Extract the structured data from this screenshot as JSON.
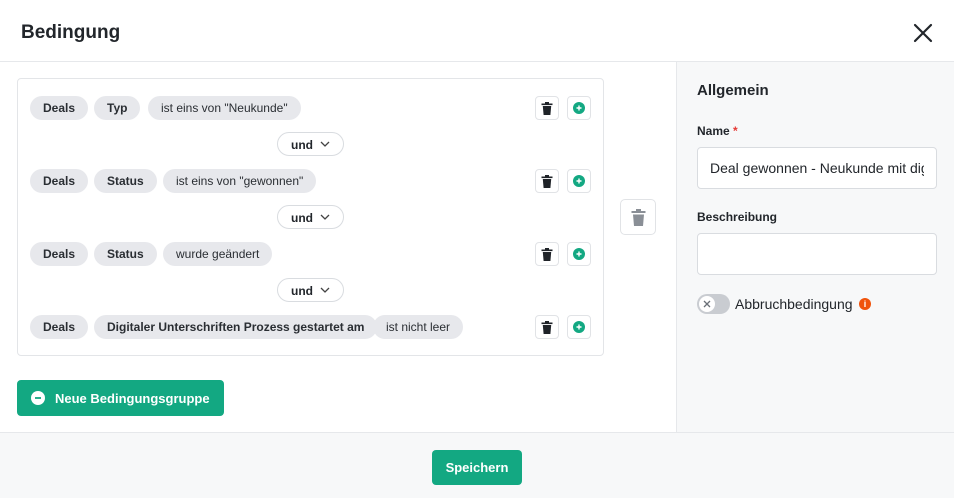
{
  "dialog": {
    "title": "Bedingung"
  },
  "conditions": [
    {
      "pills": [
        "Deals",
        "Typ",
        "ist eins von \"Neukunde\""
      ]
    },
    {
      "pills": [
        "Deals",
        "Status",
        "ist eins von \"gewonnen\""
      ]
    },
    {
      "pills": [
        "Deals",
        "Status",
        "wurde geändert"
      ]
    },
    {
      "pills": [
        "Deals",
        "Digitaler Unterschriften Prozess gestartet am",
        "ist nicht leer"
      ]
    }
  ],
  "connectors": [
    "und",
    "und",
    "und"
  ],
  "new_group_label": "Neue Bedingungsgruppe",
  "sidebar": {
    "section_title": "Allgemein",
    "name_label": "Name",
    "required_mark": "*",
    "name_value": "Deal gewonnen - Neukunde mit dig",
    "description_label": "Beschreibung",
    "description_value": "",
    "abort_label": "Abbruchbedingung",
    "abort_enabled": false,
    "info_mark": "i"
  },
  "footer": {
    "save_label": "Speichern"
  },
  "colors": {
    "accent": "#13a882",
    "info": "#f0530b",
    "pill": "#e7e8ec"
  }
}
